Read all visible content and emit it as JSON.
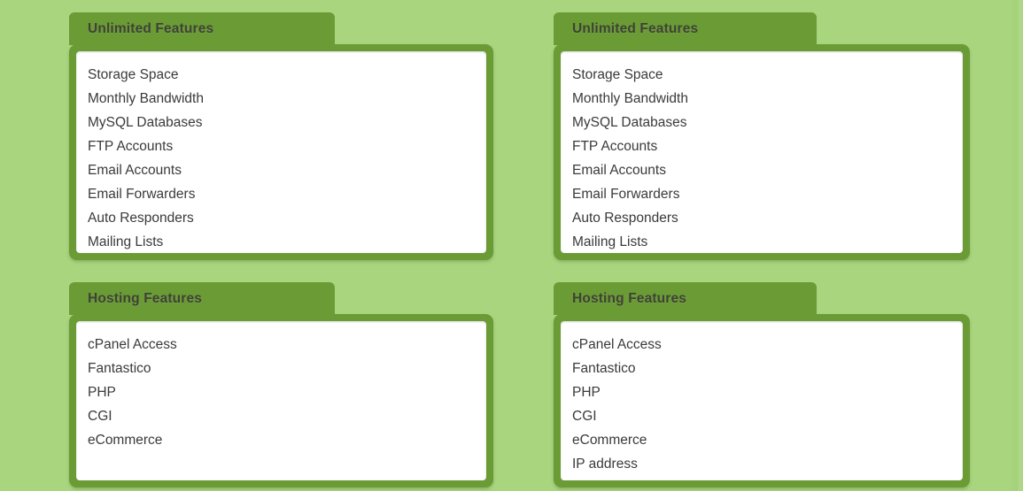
{
  "theme": {
    "background_green": "#a9d57f",
    "accent_green": "#6a9b35",
    "panel_white": "#ffffff",
    "title_color": "#3f4236",
    "text_color": "#3a3a3a"
  },
  "columns": [
    {
      "id": "column-left",
      "sections": [
        {
          "id": "unlimited-features-left",
          "title": "Unlimited Features",
          "items": [
            "Storage Space",
            "Monthly Bandwidth",
            "MySQL Databases",
            "FTP Accounts",
            "Email Accounts",
            "Email Forwarders",
            "Auto Responders",
            "Mailing Lists"
          ]
        },
        {
          "id": "hosting-features-left",
          "title": "Hosting Features",
          "items": [
            "cPanel Access",
            "Fantastico",
            "PHP",
            "CGI",
            "eCommerce"
          ]
        }
      ]
    },
    {
      "id": "column-right",
      "sections": [
        {
          "id": "unlimited-features-right",
          "title": "Unlimited Features",
          "items": [
            "Storage Space",
            "Monthly Bandwidth",
            "MySQL Databases",
            "FTP Accounts",
            "Email Accounts",
            "Email Forwarders",
            "Auto Responders",
            "Mailing Lists"
          ]
        },
        {
          "id": "hosting-features-right",
          "title": "Hosting Features",
          "items": [
            "cPanel Access",
            "Fantastico",
            "PHP",
            "CGI",
            "eCommerce",
            "IP address"
          ]
        }
      ]
    }
  ]
}
